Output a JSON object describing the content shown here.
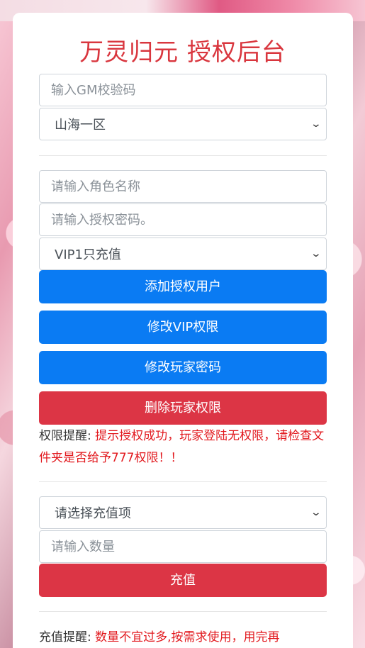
{
  "header": {
    "title": "万灵归元 授权后台"
  },
  "gm": {
    "code_placeholder": "输入GM校验码",
    "server_selected": "山海一区"
  },
  "auth": {
    "role_placeholder": "请输入角色名称",
    "password_placeholder": "请输入授权密码。",
    "vip_selected": "VIP1只充值",
    "add_label": "添加授权用户",
    "vip_label": "修改VIP权限",
    "password_label": "修改玩家密码",
    "delete_label": "删除玩家权限",
    "notice_prefix": "权限提醒: ",
    "notice_text": "提示授权成功，玩家登陆无权限，请检查文件夹是否给予777权限！！"
  },
  "recharge": {
    "item_selected": "请选择充值项",
    "amount_placeholder": "请输入数量",
    "submit_label": "充值",
    "notice_prefix": "充值提醒: ",
    "notice_text": "数量不宜过多,按需求使用，用完再"
  },
  "colors": {
    "title": "#d9363e",
    "primary": "#0a7bf3",
    "danger": "#dc3545",
    "warning_text": "#e2191e"
  }
}
